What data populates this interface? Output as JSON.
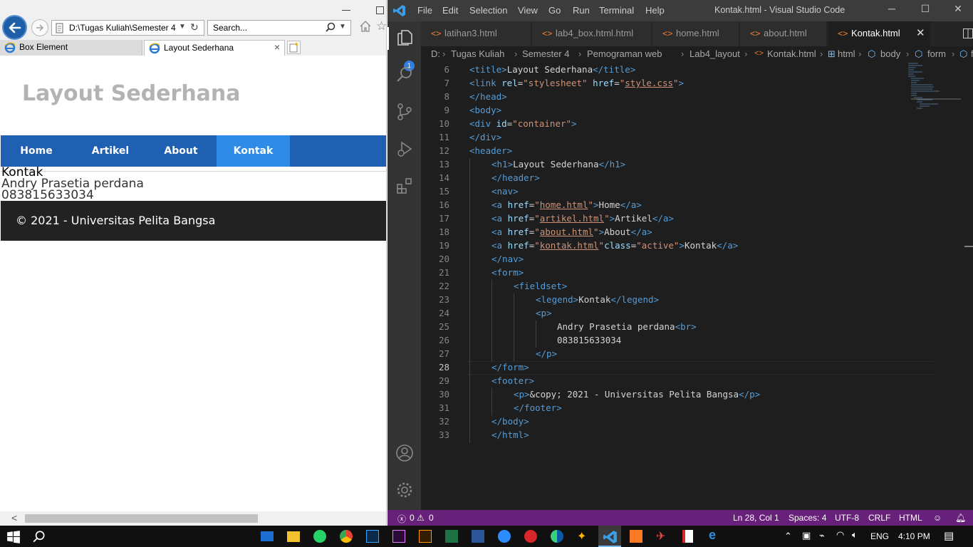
{
  "browser": {
    "address": "D:\\Tugas Kuliah\\Semester 4\\",
    "search_placeholder": "Search...",
    "tabs": [
      {
        "label": "Box Element"
      },
      {
        "label": "Layout Sederhana"
      }
    ],
    "tab_close": "×"
  },
  "page": {
    "h1": "Layout Sederhana",
    "nav": [
      "Home",
      "Artikel",
      "About",
      "Kontak"
    ],
    "legend": "Kontak",
    "name": "Andry Prasetia perdana",
    "phone": "083815633034",
    "footer": "© 2021 - Universitas Pelita Bangsa"
  },
  "vscode": {
    "menu": [
      "File",
      "Edit",
      "Selection",
      "View",
      "Go",
      "Run",
      "Terminal",
      "Help"
    ],
    "window_title": "Kontak.html - Visual Studio Code",
    "tabs": [
      {
        "label": "latihan3.html"
      },
      {
        "label": "lab4_box.html.html"
      },
      {
        "label": "home.html"
      },
      {
        "label": "about.html"
      },
      {
        "label": "Kontak.html"
      }
    ],
    "explorer_badge": "1",
    "breadcrumb": [
      "D:",
      "Tugas Kuliah",
      "Semester 4",
      "Pemograman web",
      "Lab4_layout",
      "Kontak.html",
      "html",
      "body",
      "form",
      "fieldset"
    ],
    "line_numbers": [
      "6",
      "7",
      "8",
      "9",
      "10",
      "11",
      "12",
      "13",
      "14",
      "15",
      "16",
      "17",
      "18",
      "19",
      "20",
      "21",
      "22",
      "23",
      "24",
      "25",
      "26",
      "27",
      "28",
      "29",
      "30",
      "31",
      "32",
      "33"
    ],
    "code": {
      "l6": {
        "t1": "<title>",
        "txt": "Layout Sederhana",
        "t2": "</title>"
      },
      "l7": {
        "t1": "<link ",
        "a1": "rel",
        "eq1": "=",
        "v1": "\"stylesheet\"",
        "a2": " href",
        "eq2": "=",
        "q1": "\"",
        "v2": "style.css",
        "q2": "\"",
        "t2": ">"
      },
      "l8": "</head>",
      "l9": "<body>",
      "l10": {
        "t1": "<div ",
        "a1": "id",
        "eq1": "=",
        "v1": "\"container\"",
        "t2": ">"
      },
      "l11": "</div>",
      "l12": "<header>",
      "l13": {
        "t1": "<h1>",
        "txt": "Layout Sederhana",
        "t2": "</h1>"
      },
      "l14": "</header>",
      "l15": "<nav>",
      "l16": {
        "t1": "<a ",
        "a1": "href",
        "eq1": "=",
        "q1": "\"",
        "v1": "home.html",
        "q2": "\"",
        "t2": ">",
        "txt": "Home",
        "t3": "</a>"
      },
      "l17": {
        "t1": "<a ",
        "a1": "href",
        "eq1": "=",
        "q1": "\"",
        "v1": "artikel.html",
        "q2": "\"",
        "t2": ">",
        "txt": "Artikel",
        "t3": "</a>"
      },
      "l18": {
        "t1": "<a ",
        "a1": "href",
        "eq1": "=",
        "q1": "\"",
        "v1": "about.html",
        "q2": "\"",
        "t2": ">",
        "txt": "About",
        "t3": "</a>"
      },
      "l19": {
        "t1": "<a ",
        "a1": "href",
        "eq1": "=",
        "q1": "\"",
        "v1": "kontak.html",
        "q2": "\"",
        "a2": "class",
        "eq2": "=",
        "v2": "\"active\"",
        "t2": ">",
        "txt": "Kontak",
        "t3": "</a>"
      },
      "l20": "</nav>",
      "l21": "<form>",
      "l22": "<fieldset>",
      "l23": {
        "t1": "<legend>",
        "txt": "Kontak",
        "t2": "</legend>"
      },
      "l24": "<p>",
      "l25": {
        "txt": "Andry Prasetia perdana",
        "t1": "<br>"
      },
      "l26": "083815633034",
      "l27": "</p>",
      "l28": "</form>",
      "l29": "<footer>",
      "l30": {
        "t1": "<p>",
        "txt": "&copy; 2021 - Universitas Pelita Bangsa",
        "t2": "</p>"
      },
      "l31": "</footer>",
      "l32": "</body>",
      "l33": "</html>"
    },
    "status": {
      "errors": "0",
      "warnings": "0",
      "position": "Ln 28, Col 1",
      "spaces": "Spaces: 4",
      "encoding": "UTF-8",
      "eol": "CRLF",
      "language": "HTML"
    }
  },
  "taskbar": {
    "time": "4:10 PM",
    "lang": "ENG"
  }
}
